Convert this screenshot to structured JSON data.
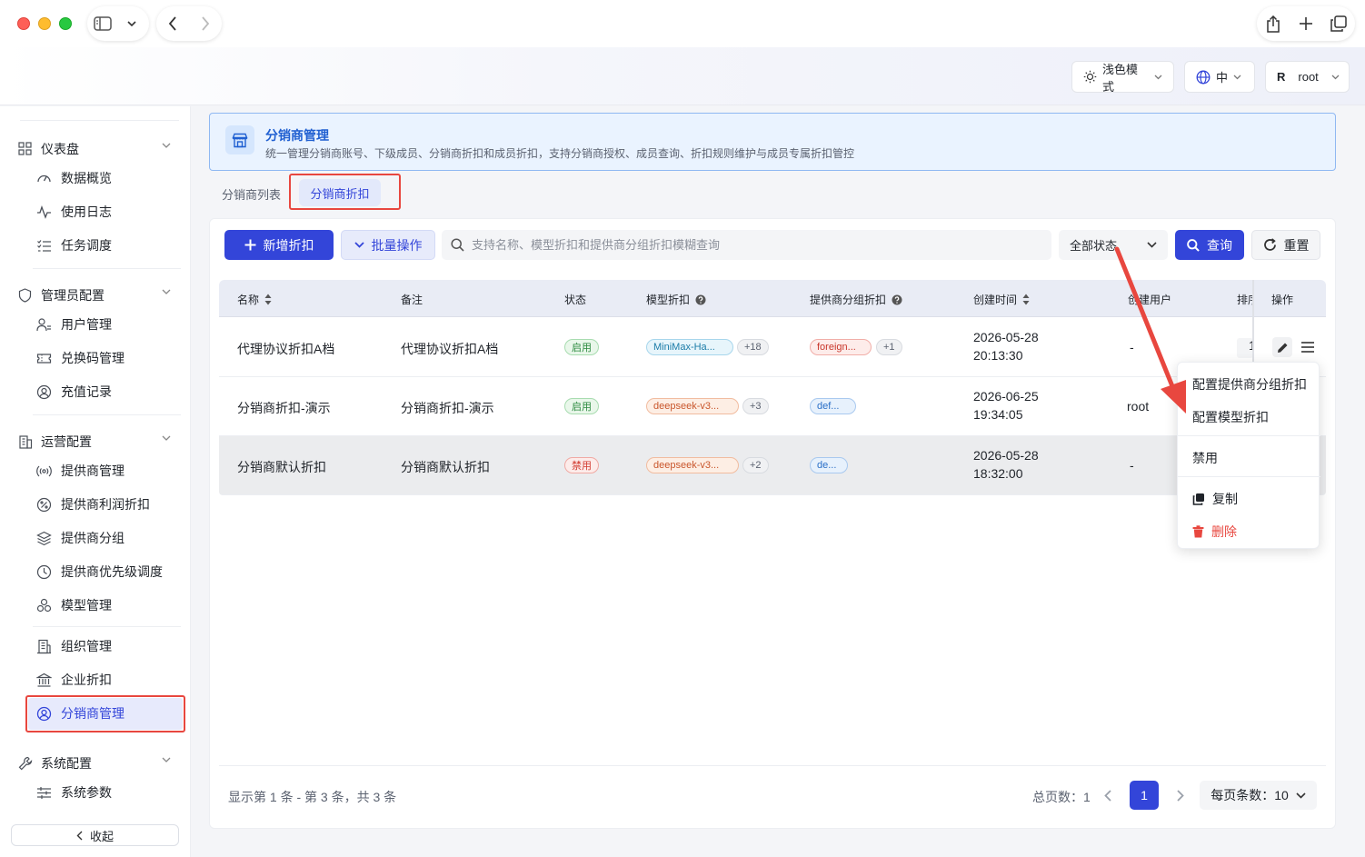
{
  "header": {
    "theme_label": "浅色模式",
    "lang_label": "中",
    "user_avatar": "R",
    "user_name": "root"
  },
  "sidebar": {
    "groups": [
      {
        "label": "仪表盘",
        "items": [
          "数据概览",
          "使用日志",
          "任务调度"
        ]
      },
      {
        "label": "管理员配置",
        "items": [
          "用户管理",
          "兑换码管理",
          "充值记录"
        ]
      },
      {
        "label": "运营配置",
        "items": [
          "提供商管理",
          "提供商利润折扣",
          "提供商分组",
          "提供商优先级调度",
          "模型管理",
          "组织管理",
          "企业折扣",
          "分销商管理"
        ]
      },
      {
        "label": "系统配置",
        "items": [
          "系统参数"
        ]
      }
    ],
    "active_item": "分销商管理",
    "collapse_label": "收起"
  },
  "banner": {
    "title": "分销商管理",
    "description": "统一管理分销商账号、下级成员、分销商折扣和成员折扣，支持分销商授权、成员查询、折扣规则维护与成员专属折扣管控"
  },
  "tabs": [
    "分销商列表",
    "分销商折扣"
  ],
  "toolbar": {
    "add_label": "新增折扣",
    "batch_label": "批量操作",
    "search_placeholder": "支持名称、模型折扣和提供商分组折扣模糊查询",
    "status_selected": "全部状态",
    "query_label": "查询",
    "reset_label": "重置"
  },
  "table": {
    "headers": {
      "name": "名称",
      "remark": "备注",
      "status": "状态",
      "model_discount": "模型折扣",
      "group_discount": "提供商分组折扣",
      "created_at": "创建时间",
      "created_by": "创建用户",
      "sort": "排序",
      "actions": "操作"
    },
    "rows": [
      {
        "name": "代理协议折扣A档",
        "remark": "代理协议折扣A档",
        "status": "启用",
        "model_tag": "MiniMax-Ha...",
        "model_more": "+18",
        "group_tag": "foreign...",
        "group_more": "+1",
        "date": "2026-05-28",
        "time": "20:13:30",
        "user": "-",
        "sort": "1"
      },
      {
        "name": "分销商折扣-演示",
        "remark": "分销商折扣-演示",
        "status": "启用",
        "model_tag": "deepseek-v3...",
        "model_more": "+3",
        "group_tag": "def...",
        "group_more": "",
        "date": "2026-06-25",
        "time": "19:34:05",
        "user": "root",
        "sort": ""
      },
      {
        "name": "分销商默认折扣",
        "remark": "分销商默认折扣",
        "status": "禁用",
        "model_tag": "deepseek-v3...",
        "model_more": "+2",
        "group_tag": "de...",
        "group_more": "",
        "date": "2026-05-28",
        "time": "18:32:00",
        "user": "-",
        "sort": ""
      }
    ]
  },
  "context_menu": {
    "items": [
      "配置提供商分组折扣",
      "配置模型折扣",
      "禁用",
      "复制",
      "删除"
    ]
  },
  "footer": {
    "info": "显示第 1 条 - 第 3 条，共 3 条",
    "total_pages_label": "总页数：",
    "total_pages": "1",
    "current_page": "1",
    "page_size_label": "每页条数：",
    "page_size": "10"
  },
  "colors": {
    "primary": "#3345d9",
    "highlight_annotation": "#e8473f"
  }
}
